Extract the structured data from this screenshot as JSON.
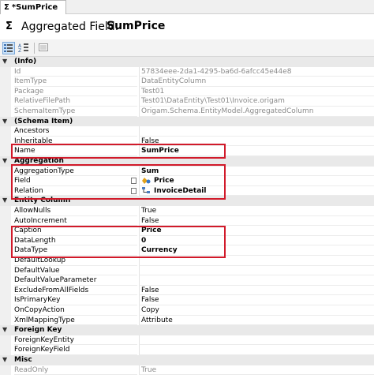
{
  "tab": {
    "icon": "sigma-icon",
    "title": "*SumPrice"
  },
  "header": {
    "icon": "sigma-icon",
    "prefix": "Aggregated Field:",
    "name": "SumPrice"
  },
  "toolbar": {
    "buttons": [
      "categorized-view-icon",
      "alphabetical-view-icon",
      "property-pages-icon"
    ]
  },
  "rows": [
    {
      "kind": "cat",
      "label": "(Info)"
    },
    {
      "label": "Id",
      "value": "57834eee-2da1-4295-ba6d-6afcc45e44e8",
      "readonly": true
    },
    {
      "label": "ItemType",
      "value": "DataEntityColumn",
      "readonly": true
    },
    {
      "label": "Package",
      "value": "Test01",
      "readonly": true
    },
    {
      "label": "RelativeFilePath",
      "value": "Test01\\DataEntity\\Test01\\Invoice.origam",
      "readonly": true
    },
    {
      "label": "SchemaItemType",
      "value": "Origam.Schema.EntityModel.AggregatedColumn",
      "readonly": true
    },
    {
      "kind": "cat",
      "label": "(Schema Item)"
    },
    {
      "label": "Ancestors",
      "value": ""
    },
    {
      "label": "Inheritable",
      "value": "False"
    },
    {
      "label": "Name",
      "value": "SumPrice",
      "bold": true
    },
    {
      "kind": "cat",
      "label": "Aggregation"
    },
    {
      "label": "AggregationType",
      "value": "Sum",
      "bold": true
    },
    {
      "label": "Field",
      "value": "Price",
      "bold": true,
      "icon": "field-icon",
      "ellipsis": true
    },
    {
      "label": "Relation",
      "value": "InvoiceDetail",
      "bold": true,
      "icon": "relation-icon",
      "ellipsis": true
    },
    {
      "kind": "cat",
      "label": "Entity Column"
    },
    {
      "label": "AllowNulls",
      "value": "True"
    },
    {
      "label": "AutoIncrement",
      "value": "False"
    },
    {
      "label": "Caption",
      "value": "Price",
      "bold": true
    },
    {
      "label": "DataLength",
      "value": "0",
      "bold": true
    },
    {
      "label": "DataType",
      "value": "Currency",
      "bold": true
    },
    {
      "label": "DefaultLookup",
      "value": ""
    },
    {
      "label": "DefaultValue",
      "value": ""
    },
    {
      "label": "DefaultValueParameter",
      "value": ""
    },
    {
      "label": "ExcludeFromAllFields",
      "value": "False"
    },
    {
      "label": "IsPrimaryKey",
      "value": "False"
    },
    {
      "label": "OnCopyAction",
      "value": "Copy"
    },
    {
      "label": "XmlMappingType",
      "value": "Attribute"
    },
    {
      "kind": "cat",
      "label": "Foreign Key"
    },
    {
      "label": "ForeignKeyEntity",
      "value": ""
    },
    {
      "label": "ForeignKeyField",
      "value": ""
    },
    {
      "kind": "cat",
      "label": "Misc"
    },
    {
      "label": "ReadOnly",
      "value": "True",
      "readonly": true
    }
  ]
}
